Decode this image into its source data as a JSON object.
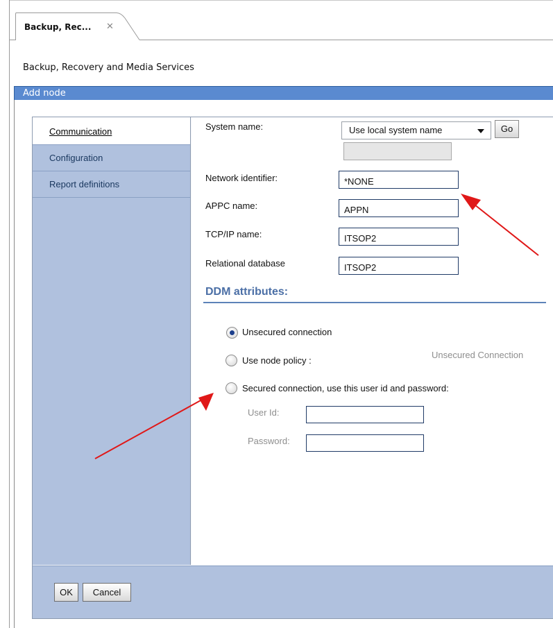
{
  "tab": {
    "label": "Backup, Rec...",
    "close": "✕"
  },
  "app_title": "Backup, Recovery and Media Services",
  "dialog": {
    "title": "Add node"
  },
  "sidebar": {
    "items": [
      {
        "label": "Communication"
      },
      {
        "label": "Configuration"
      },
      {
        "label": "Report definitions"
      }
    ]
  },
  "form": {
    "system_name": {
      "label": "System name:",
      "select_value": "Use local system name",
      "go_label": "Go"
    },
    "network_identifier": {
      "label": "Network identifier:",
      "value": "*NONE"
    },
    "appc_name": {
      "label": "APPC name:",
      "value": "APPN"
    },
    "tcpip_name": {
      "label": "TCP/IP name:",
      "value": "ITSOP2"
    },
    "relational_database": {
      "label": "Relational database",
      "value": "ITSOP2"
    }
  },
  "ddm": {
    "header": "DDM attributes:",
    "options": [
      {
        "label": "Unsecured connection",
        "checked": true
      },
      {
        "label": "Use node policy :",
        "checked": false,
        "note": "Unsecured Connection"
      },
      {
        "label": "Secured connection, use this user id and password:",
        "checked": false
      }
    ],
    "user_id_label": "User Id:",
    "password_label": "Password:"
  },
  "buttons": {
    "ok": "OK",
    "cancel": "Cancel"
  },
  "colors": {
    "titlebar": "#5a8ad0",
    "sidebar": "#b0c1de",
    "accent_header": "#4b6fa6",
    "annotation_arrow": "#e01818"
  }
}
